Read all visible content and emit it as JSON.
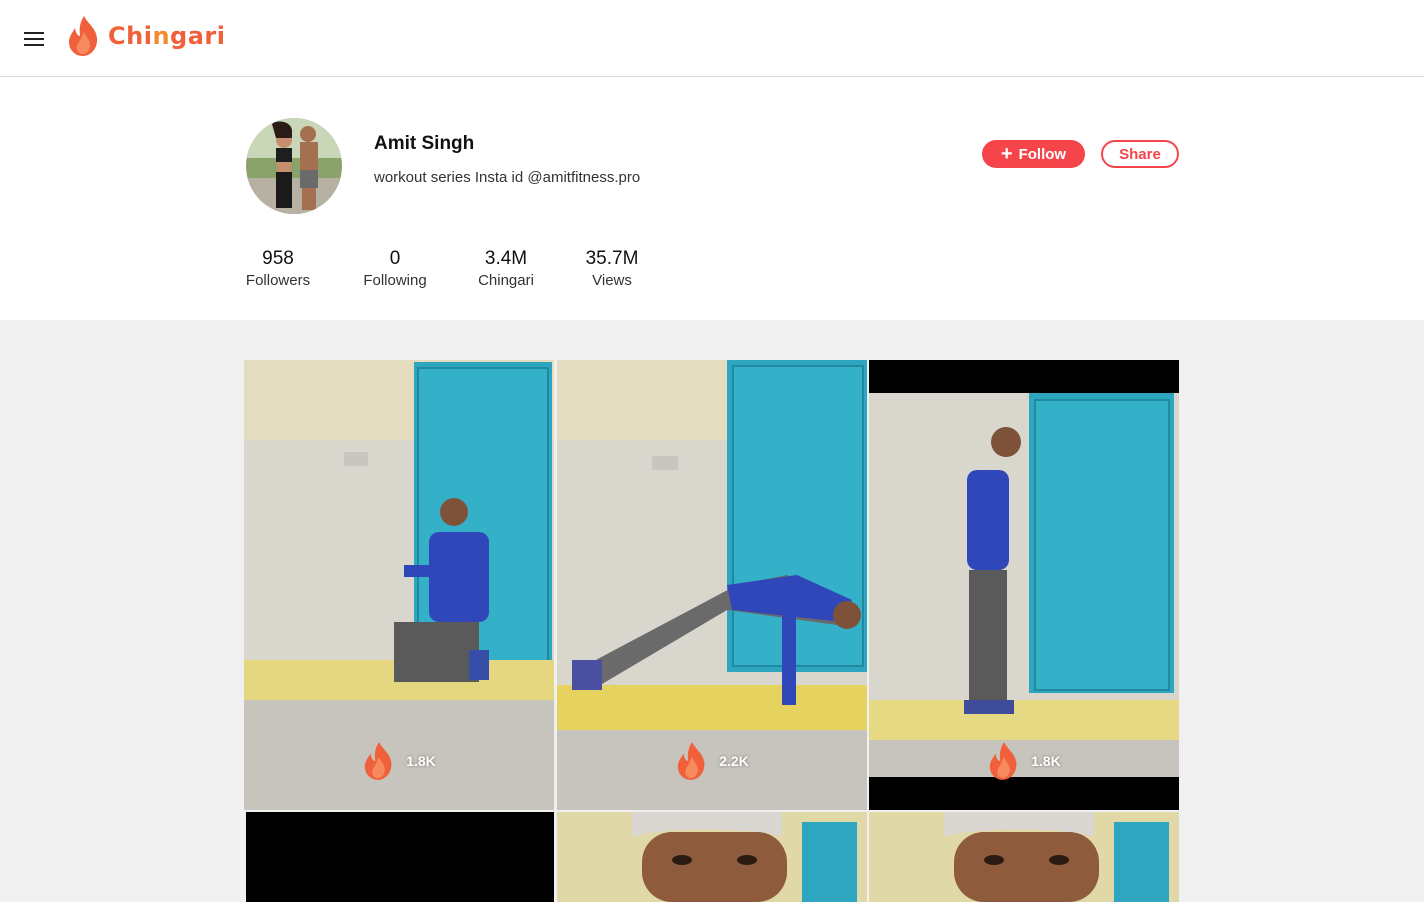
{
  "app": {
    "name": "Chingari",
    "logo_text_left": "Chi",
    "logo_text_mid": "n",
    "logo_text_right": "gari",
    "brand_color": "#f0603a",
    "accent_color": "#f5454b"
  },
  "profile": {
    "name": "Amit Singh",
    "bio": "workout series Insta id @amitfitness.pro",
    "follow_label": "Follow",
    "share_label": "Share",
    "stats": [
      {
        "value": "958",
        "label": "Followers"
      },
      {
        "value": "0",
        "label": "Following"
      },
      {
        "value": "3.4M",
        "label": "Chingari"
      },
      {
        "value": "35.7M",
        "label": "Views"
      }
    ]
  },
  "videos": [
    {
      "likes": "1.8K",
      "scene": "kneeling-thumbs-up"
    },
    {
      "likes": "2.2K",
      "scene": "pushup"
    },
    {
      "likes": "1.8K",
      "scene": "standing-side"
    },
    {
      "likes": "",
      "scene": "black"
    },
    {
      "likes": "",
      "scene": "face-cap"
    },
    {
      "likes": "",
      "scene": "face-cap"
    }
  ],
  "icons": {
    "menu": "hamburger-menu-icon",
    "flame": "flame-icon",
    "plus": "plus-icon"
  }
}
